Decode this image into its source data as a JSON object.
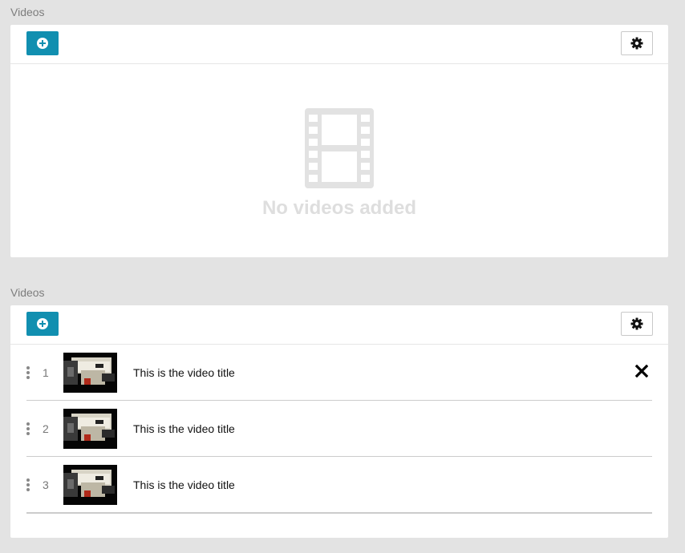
{
  "sections": [
    {
      "label": "Videos",
      "empty_message": "No videos added"
    },
    {
      "label": "Videos",
      "videos": [
        {
          "index": "1",
          "title": "This is the video title"
        },
        {
          "index": "2",
          "title": "This is the video title"
        },
        {
          "index": "3",
          "title": "This is the video title"
        }
      ]
    }
  ],
  "icons": {
    "add": "plus-circle-icon",
    "settings": "gear-icon",
    "empty": "film-icon",
    "remove": "close-icon",
    "drag": "drag-handle-icon"
  },
  "colors": {
    "accent": "#118fb0",
    "background": "#e3e3e3",
    "empty_text": "#dedede"
  }
}
